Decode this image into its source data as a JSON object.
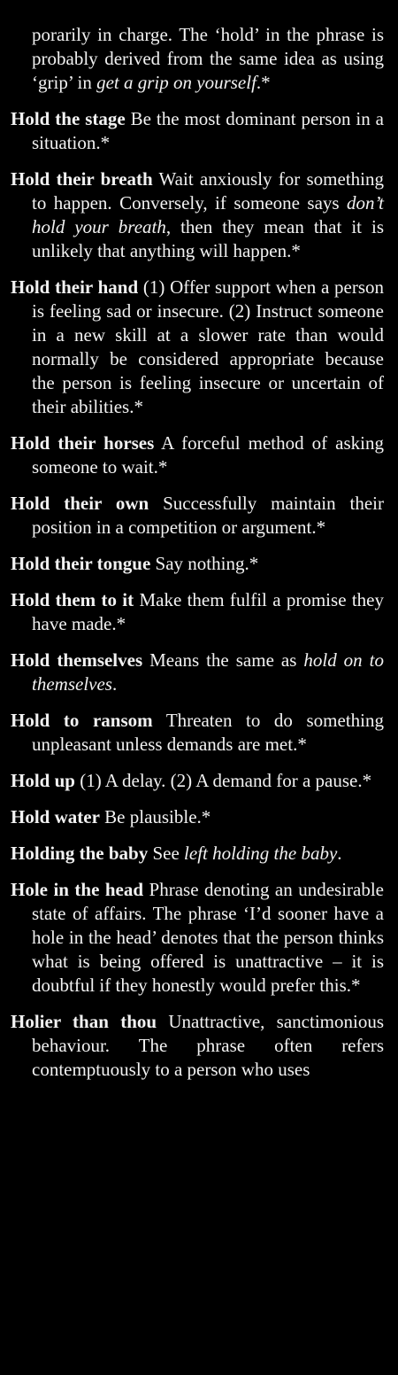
{
  "entries": [
    {
      "continuation": true,
      "parts": [
        {
          "t": "porarily in charge. The ‘hold’ in the phrase is probably derived from the same idea as using ‘grip’ in "
        },
        {
          "t": "get a grip on yourself",
          "i": true
        },
        {
          "t": ".*"
        }
      ]
    },
    {
      "parts": [
        {
          "t": "Hold the stage",
          "b": true
        },
        {
          "t": " Be the most dominant person in a situation.*"
        }
      ]
    },
    {
      "parts": [
        {
          "t": "Hold their breath",
          "b": true
        },
        {
          "t": " Wait anxiously for something to happen. Conversely, if someone says "
        },
        {
          "t": "don’t hold your breath",
          "i": true
        },
        {
          "t": ", then they mean that it is unlikely that anything will happen.*"
        }
      ]
    },
    {
      "parts": [
        {
          "t": "Hold their hand",
          "b": true
        },
        {
          "t": " (1) Offer support when a person is feeling sad or insecure. (2) Instruct someone in a new skill at a slower rate than would normally be considered appropriate because the person is feeling insecure or uncertain of their abilities.*"
        }
      ]
    },
    {
      "parts": [
        {
          "t": "Hold their horses",
          "b": true
        },
        {
          "t": " A forceful method of asking someone to wait.*"
        }
      ]
    },
    {
      "parts": [
        {
          "t": "Hold their own",
          "b": true
        },
        {
          "t": " Successfully maintain their position in a competition or argument.*"
        }
      ]
    },
    {
      "parts": [
        {
          "t": "Hold their tongue",
          "b": true
        },
        {
          "t": " Say nothing.*"
        }
      ]
    },
    {
      "parts": [
        {
          "t": "Hold them to it",
          "b": true
        },
        {
          "t": " Make them fulfil a promise they have made.*"
        }
      ]
    },
    {
      "parts": [
        {
          "t": "Hold themselves",
          "b": true
        },
        {
          "t": " Means the same as "
        },
        {
          "t": "hold on to themselves",
          "i": true
        },
        {
          "t": "."
        }
      ]
    },
    {
      "parts": [
        {
          "t": "Hold to ransom",
          "b": true
        },
        {
          "t": " Threaten to do something unpleasant unless demands are met.*"
        }
      ]
    },
    {
      "parts": [
        {
          "t": "Hold up",
          "b": true
        },
        {
          "t": " (1) A delay. (2) A demand for a pause.*"
        }
      ]
    },
    {
      "parts": [
        {
          "t": "Hold water",
          "b": true
        },
        {
          "t": " Be plausible.*"
        }
      ]
    },
    {
      "parts": [
        {
          "t": "Holding the baby",
          "b": true
        },
        {
          "t": " See "
        },
        {
          "t": "left holding the baby",
          "i": true
        },
        {
          "t": "."
        }
      ]
    },
    {
      "parts": [
        {
          "t": "Hole in the head",
          "b": true
        },
        {
          "t": " Phrase denoting an undesirable state of affairs. The phrase ‘I’d sooner have a hole in the head’ denotes that the person thinks what is being offered is unattractive – it is doubtful if they honestly would prefer this.*"
        }
      ]
    },
    {
      "parts": [
        {
          "t": "Holier than thou",
          "b": true
        },
        {
          "t": " Unattractive, sanctimonious behaviour. The phrase often refers contemptuously to a person who uses"
        }
      ]
    }
  ]
}
